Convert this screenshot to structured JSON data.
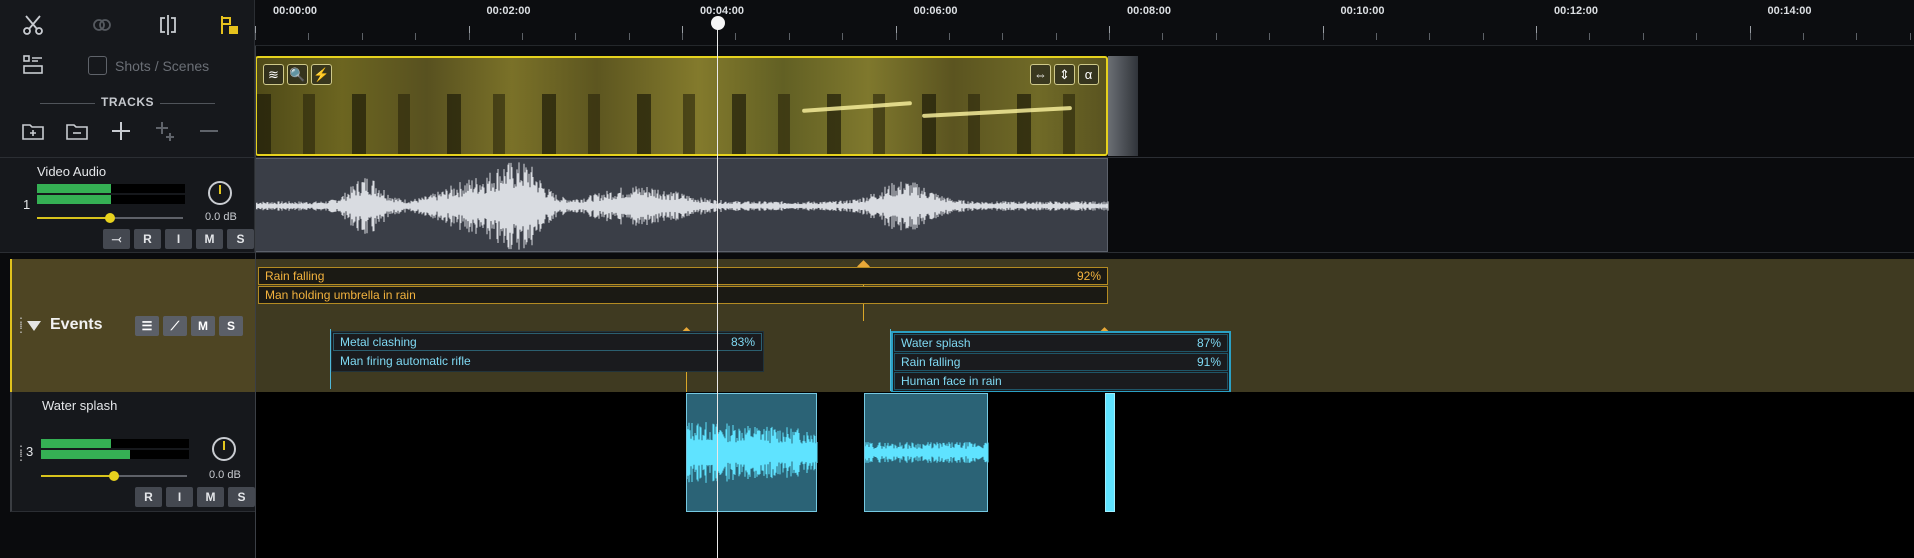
{
  "toolbar": {
    "icons": [
      "scissors-icon",
      "link-icon",
      "split-icon",
      "snap-icon",
      "layout-icon"
    ],
    "shots_scenes_label": "Shots / Scenes",
    "tracks_label": "TRACKS",
    "track_tools": [
      "add-folder-icon",
      "folder-icon",
      "add-track-icon",
      "add-multi-track-icon",
      "remove-track-icon"
    ]
  },
  "ruler": {
    "labels": [
      "00:00:00",
      "00:02:00",
      "00:04:00",
      "00:06:00",
      "00:08:00",
      "00:10:00",
      "00:12:00",
      "00:14:00"
    ]
  },
  "video_track": {
    "clip_icons_left": [
      "≋",
      "🔍",
      "⚡"
    ],
    "clip_icons_right": [
      "⇔",
      "⇕",
      "α"
    ]
  },
  "audio_track_1": {
    "name": "Video Audio",
    "number": "1",
    "volume": "0.0 dB",
    "meter_levels": [
      0.5,
      0.5
    ],
    "fader_level": 0.5,
    "buttons": [
      "⤙",
      "R",
      "I",
      "M",
      "S"
    ]
  },
  "events_track": {
    "name": "Events",
    "buttons": [
      "☰",
      "⟋",
      "M",
      "S"
    ],
    "groups": [
      {
        "items": [
          {
            "label": "Rain falling",
            "confidence": "92%"
          },
          {
            "label": "Man holding umbrella in rain",
            "confidence": ""
          }
        ]
      },
      {
        "items": [
          {
            "label": "Metal clashing",
            "confidence": "83%"
          },
          {
            "label": "Man firing automatic rifle",
            "confidence": ""
          }
        ]
      },
      {
        "items": [
          {
            "label": "Water splash",
            "confidence": "87%"
          },
          {
            "label": "Rain falling",
            "confidence": "91%"
          },
          {
            "label": "Human face in rain",
            "confidence": ""
          }
        ]
      }
    ]
  },
  "audio_track_3": {
    "name": "Water splash",
    "number": "3",
    "volume": "0.0 dB",
    "meter_levels": [
      0.47,
      0.6
    ],
    "fader_level": 0.5,
    "buttons": [
      "R",
      "I",
      "M",
      "S"
    ]
  },
  "colors": {
    "accent": "#e6d21d",
    "meter_green": "#35b054",
    "event_cyan": "#7fd9f3",
    "event_orange": "#f3b33e",
    "sfx_clip": "#2b6376"
  }
}
